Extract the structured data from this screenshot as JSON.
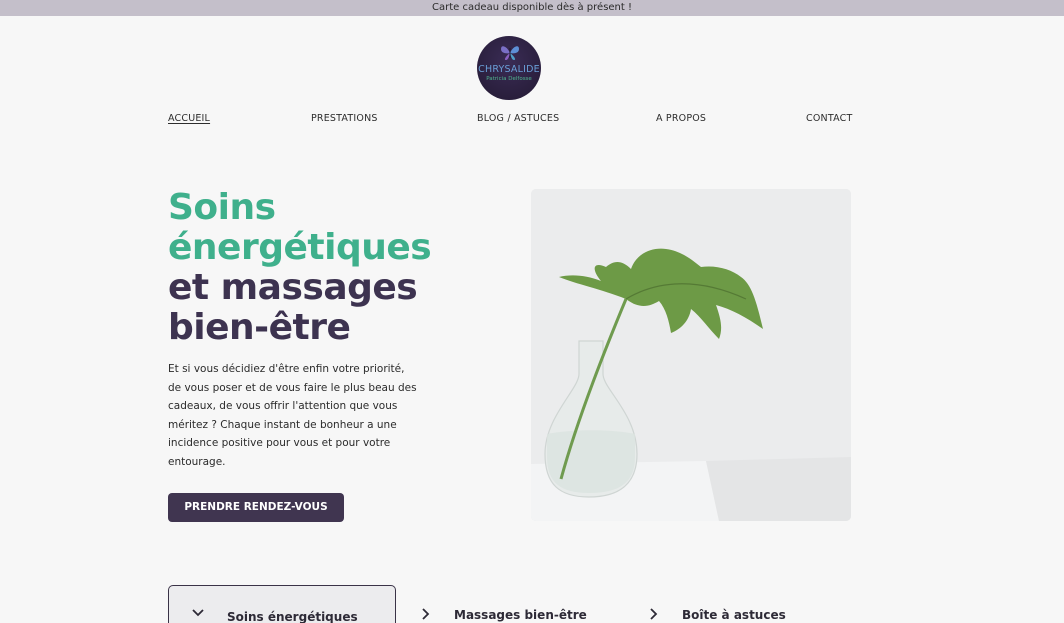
{
  "announcement": "Carte cadeau disponible dès à présent !",
  "logo": {
    "line1": "CHRYSALIDE",
    "line2": "Patricia Delfosse"
  },
  "nav": {
    "items": [
      {
        "label": "ACCUEIL",
        "active": true
      },
      {
        "label": "PRESTATIONS"
      },
      {
        "label": "BLOG / ASTUCES"
      },
      {
        "label": "A PROPOS"
      },
      {
        "label": "CONTACT"
      }
    ]
  },
  "hero": {
    "title_line1": "Soins",
    "title_line2": "énergétiques",
    "title_line3": "et massages",
    "title_line4": "bien-être",
    "text": "Et si vous décidiez d'être enfin votre priorité, de vous poser et de vous faire le plus beau des cadeaux, de vous offrir l'attention que vous méritez ? Chaque instant de bonheur a une incidence positive pour vous et pour votre entourage.",
    "cta": "PRENDRE RENDEZ-VOUS"
  },
  "tabs": [
    {
      "label": "Soins énergétiques",
      "icon": "chevron-down-icon",
      "active": true
    },
    {
      "label": "Massages bien-être",
      "icon": "chevron-right-icon"
    },
    {
      "label": "Boîte à astuces",
      "icon": "chevron-right-icon"
    }
  ],
  "colors": {
    "accent_green": "#3fb08c",
    "dark_purple": "#403550",
    "announce_bg": "#c4bfca"
  }
}
